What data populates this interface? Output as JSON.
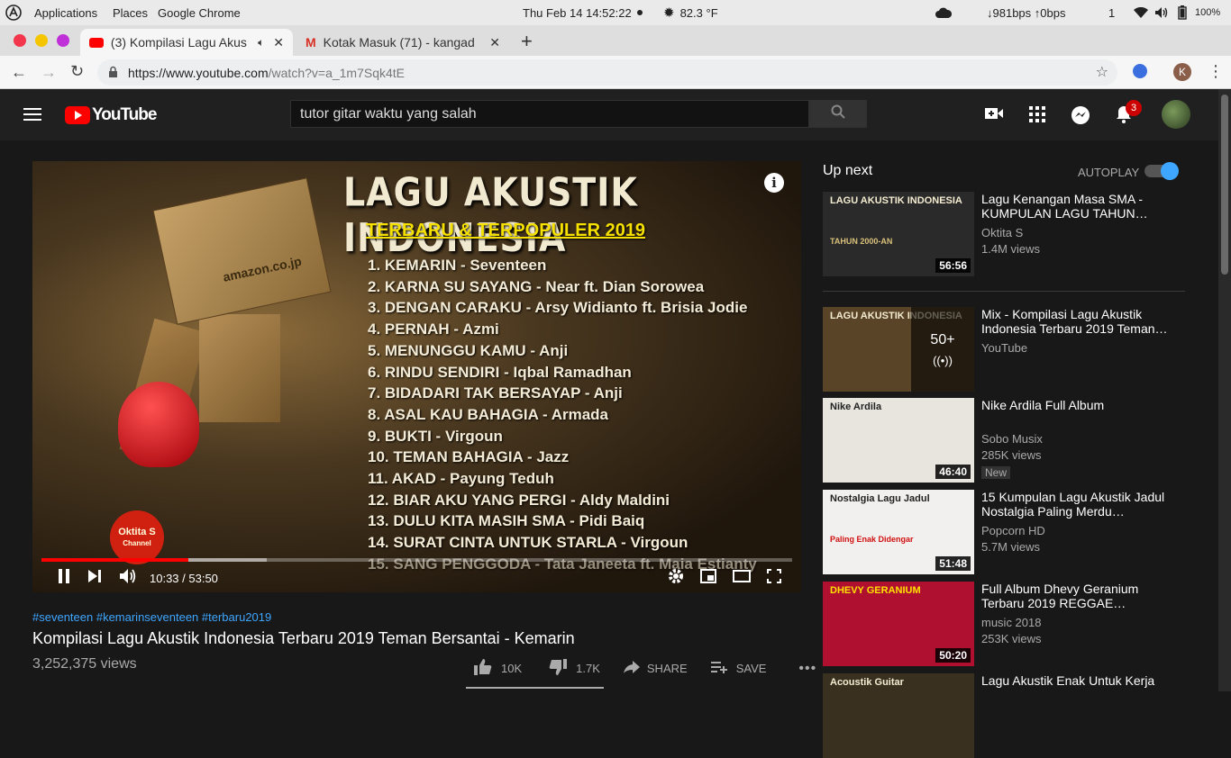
{
  "system_bar": {
    "applications": "Applications",
    "places": "Places",
    "browser_name": "Google Chrome",
    "datetime": "Thu Feb 14  14:52:22",
    "weather": "82.3 °F",
    "network": "↓981bps ↑0bps",
    "workspace": "1",
    "battery": "100%"
  },
  "tabs": [
    {
      "title": "(3) Kompilasi Lagu Akus"
    },
    {
      "title": "Kotak Masuk (71) - kangad"
    }
  ],
  "url": {
    "host": "https://www.youtube.com",
    "path": "/watch?v=a_1m7Sqk4tE",
    "profile_initial": "K"
  },
  "youtube_header": {
    "logo": "YouTube",
    "search_value": "tutor gitar waktu yang salah",
    "notification_count": "3"
  },
  "player": {
    "title": "LAGU AKUSTIK INDONESIA",
    "subtitle": "TERBARU & TERPOPULER 2019",
    "channel_logo": "Oktita S",
    "channel_logo_sub": "Channel",
    "box_label": "amazon.co.jp",
    "songs": [
      "1.  KEMARIN - Seventeen",
      "2.  KARNA SU SAYANG - Near ft. Dian Sorowea",
      "3.  DENGAN CARAKU - Arsy Widianto ft. Brisia Jodie",
      "4.  PERNAH - Azmi",
      "5.  MENUNGGU KAMU - Anji",
      "6.  RINDU SENDIRI - Iqbal Ramadhan",
      "7.  BIDADARI TAK BERSAYAP - Anji",
      "8.  ASAL KAU BAHAGIA - Armada",
      "9.  BUKTI - Virgoun",
      "10. TEMAN BAHAGIA - Jazz",
      "11. AKAD - Payung Teduh",
      "12. BIAR AKU YANG PERGI - Aldy Maldini",
      "13. DULU KITA MASIH SMA - Pidi Baiq",
      "14. SURAT CINTA UNTUK STARLA - Virgoun",
      "15. SANG PENGGODA - Tata Janeeta ft. Maia Estianty"
    ],
    "time": "10:33 / 53:50",
    "progress_fraction": 0.196,
    "buffered_fraction": 0.3
  },
  "video_info": {
    "hashtags": "#seventeen #kemarinseventeen #terbaru2019",
    "title": "Kompilasi Lagu Akustik Indonesia Terbaru 2019 Teman Bersantai - Kemarin",
    "views": "3,252,375 views",
    "likes": "10K",
    "dislikes": "1.7K",
    "share": "SHARE",
    "save": "SAVE"
  },
  "up_next": {
    "heading": "Up next",
    "autoplay": "AUTOPLAY",
    "items": [
      {
        "title": "Lagu Kenangan Masa SMA - KUMPULAN LAGU TAHUN…",
        "channel": "Oktita S",
        "views": "1.4M views",
        "duration": "56:56",
        "thumb_text": "LAGU AKUSTIK INDONESIA",
        "thumb_sub": "TAHUN 2000-AN",
        "thumb_color": "#2a2a2a"
      },
      {
        "title": "Mix - Kompilasi Lagu Akustik Indonesia Terbaru 2019 Teman…",
        "channel": "YouTube",
        "views": "",
        "duration": "",
        "count": "50+",
        "thumb_text": "LAGU AKUSTIK INDONESIA",
        "thumb_color": "#5a4428"
      },
      {
        "title": "Nike Ardila Full Album",
        "channel": "Sobo Musix",
        "views": "285K views",
        "duration": "46:40",
        "badge": "New",
        "thumb_text": "Nike Ardila",
        "thumb_color": "#e8e4de"
      },
      {
        "title": "15 Kumpulan Lagu Akustik Jadul Nostalgia Paling Merdu…",
        "channel": "Popcorn HD",
        "views": "5.7M views",
        "duration": "51:48",
        "thumb_text": "Nostalgia Lagu Jadul",
        "thumb_sub": "Paling Enak Didengar",
        "thumb_color": "#f2f0ee"
      },
      {
        "title": "Full Album Dhevy Geranium Terbaru 2019 REGGAE…",
        "channel": "music 2018",
        "views": "253K views",
        "duration": "50:20",
        "thumb_text": "DHEVY GERANIUM",
        "thumb_color": "#b01030"
      },
      {
        "title": "Lagu Akustik Enak Untuk Kerja",
        "channel": "",
        "views": "",
        "duration": "",
        "thumb_text": "Acoustik Guitar",
        "thumb_color": "#3a3020"
      }
    ]
  }
}
